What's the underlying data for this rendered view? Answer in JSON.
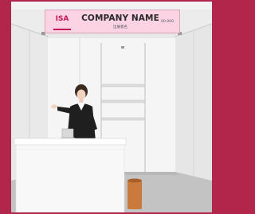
{
  "fascia": {
    "logo_text": "ISA",
    "company_name": "COMPANY NAME",
    "company_subtitle": "出展者名",
    "booth_number": "00-000"
  },
  "colors": {
    "background": "#b3264c",
    "fascia_pink": "#fbd3e3",
    "logo_magenta": "#c2185b",
    "wall_white": "#f4f4f4",
    "carpet_gray": "#bdbdbd",
    "waste_bin": "#c97a3c",
    "staff_jacket": "#1f1f1f"
  },
  "scene": {
    "type": "exhibition-booth-rendering",
    "elements": [
      "fascia-sign",
      "back-wall",
      "side-walls",
      "shelves",
      "reception-counter",
      "staff-person",
      "laptop",
      "waste-bin",
      "carpet"
    ]
  }
}
